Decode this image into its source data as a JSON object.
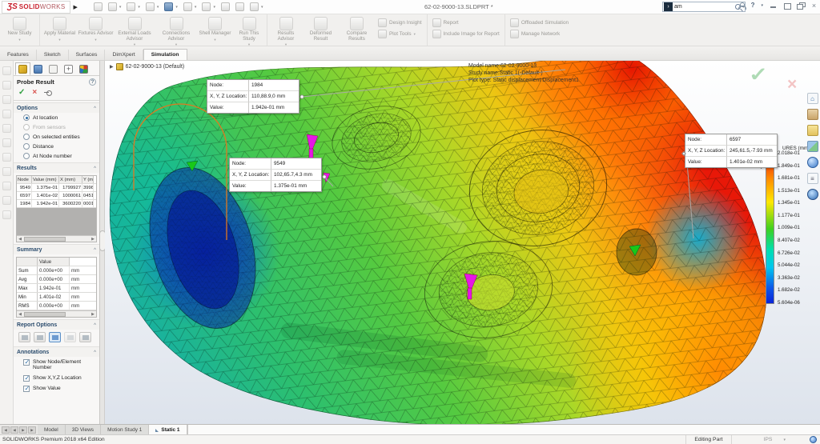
{
  "colors": {
    "accent-red": "#c8202d",
    "check-green": "#2e9e3e",
    "cancel-red": "#d9534f",
    "magenta": "#e616e6",
    "legend-border": "#8a8a8a"
  },
  "icons": {
    "check": "✓",
    "cross": "×",
    "caret-down": "▾",
    "chevron-up": "^",
    "tree-arrow": "▶",
    "nav-first": "◀",
    "nav-last": "▶",
    "help": "?"
  },
  "titlebar": {
    "logo_mark": "ƷS",
    "logo_bold": "SOLID",
    "logo_light": "WORKS",
    "document": "62-02-9000-13.SLDPRT *",
    "search_value": "am"
  },
  "ribbon": {
    "large": [
      {
        "label": "New Study"
      },
      {
        "label": "Apply Material"
      },
      {
        "label": "Fixtures Advisor"
      },
      {
        "label": "External Loads Advisor"
      },
      {
        "label": "Connections Advisor"
      },
      {
        "label": "Shell Manager"
      },
      {
        "label": "Run This Study"
      },
      {
        "label": "Results Advisor"
      },
      {
        "label": "Deformed Result"
      },
      {
        "label": "Compare Results"
      }
    ],
    "small": [
      {
        "label": "Design Insight"
      },
      {
        "label": "Plot Tools"
      },
      {
        "label": "Report"
      },
      {
        "label": "Include Image for Report"
      },
      {
        "label": "Offloaded Simulation"
      },
      {
        "label": "Manage Network"
      }
    ]
  },
  "command_tabs": {
    "items": [
      "Features",
      "Sketch",
      "Surfaces",
      "DimXpert",
      "Simulation"
    ],
    "active": "Simulation"
  },
  "pm": {
    "title": "Probe Result",
    "options": {
      "header": "Options",
      "radios": [
        {
          "label": "At location",
          "checked": true,
          "disabled": false
        },
        {
          "label": "From sensors",
          "checked": false,
          "disabled": true
        },
        {
          "label": "On selected entities",
          "checked": false,
          "disabled": false
        },
        {
          "label": "Distance",
          "checked": false,
          "disabled": false
        },
        {
          "label": "At Node number",
          "checked": false,
          "disabled": false
        }
      ]
    },
    "results": {
      "header": "Results",
      "columns": [
        "Node",
        "Value (mm)",
        "X (mm)",
        "Y (m"
      ],
      "rows": [
        [
          "9549",
          "1.375e-01",
          "1799927",
          "3998"
        ],
        [
          "6597",
          "1.401e-02",
          "1000061",
          "0451"
        ],
        [
          "1984",
          "1.942e-01",
          "3600220",
          "0001"
        ]
      ]
    },
    "summary": {
      "header": "Summary",
      "value_header": "Value",
      "rows": [
        [
          "Sum",
          "0.000e+00",
          "mm"
        ],
        [
          "Avg",
          "0.000e+00",
          "mm"
        ],
        [
          "Max",
          "1.942e-01",
          "mm"
        ],
        [
          "Min",
          "1.401e-02",
          "mm"
        ],
        [
          "RMS",
          "0.000e+00",
          "mm"
        ]
      ]
    },
    "report_options": {
      "header": "Report Options"
    },
    "annotations": {
      "header": "Annotations",
      "checkboxes": [
        {
          "label": "Show Node/Element Number",
          "checked": true
        },
        {
          "label": "Show X,Y,Z Location",
          "checked": true
        },
        {
          "label": "Show Value",
          "checked": true
        }
      ]
    }
  },
  "viewport": {
    "tree_item": "62-02-9000-13 (Default)",
    "model_info": [
      "Model name:62-02-9000-13",
      "Study name:Static 1(-Default-)",
      "Plot type: Static displacement Displacement1"
    ],
    "callout_labels": {
      "node": "Node:",
      "loc": "X, Y, Z Location:",
      "val": "Value:"
    },
    "callouts": [
      {
        "node": "1984",
        "loc": "110,88.9,0 mm",
        "val": "1.942e-01  mm"
      },
      {
        "node": "9549",
        "loc": "102,65.7,4.3 mm",
        "val": "1.375e-01  mm"
      },
      {
        "node": "6597",
        "loc": "245,61.5,-7.93 mm",
        "val": "1.401e-02  mm"
      }
    ],
    "legend": {
      "title": "URES (mm)",
      "labels": [
        "2.018e-01",
        "1.849e-01",
        "1.681e-01",
        "1.513e-01",
        "1.345e-01",
        "1.177e-01",
        "1.009e-01",
        "8.407e-02",
        "6.726e-02",
        "5.044e-02",
        "3.363e-02",
        "1.682e-02",
        "5.604e-06"
      ]
    }
  },
  "bottom": {
    "tabs": [
      "Model",
      "3D Views",
      "Motion Study 1",
      "Static 1"
    ],
    "active": "Static 1"
  },
  "statusbar": {
    "edition": "SOLIDWORKS Premium 2018 x64 Edition",
    "mode": "Editing Part",
    "units": "IPS"
  }
}
